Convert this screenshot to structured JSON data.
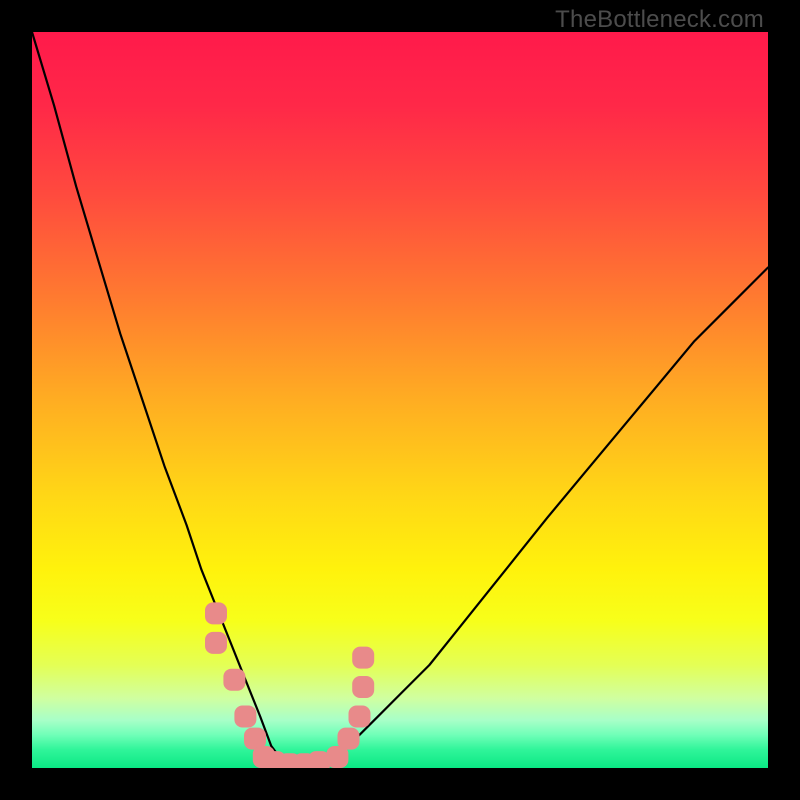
{
  "watermark": "TheBottleneck.com",
  "gradient_stops": [
    {
      "offset": 0.0,
      "color": "#ff1a4b"
    },
    {
      "offset": 0.1,
      "color": "#ff2848"
    },
    {
      "offset": 0.22,
      "color": "#ff4a3e"
    },
    {
      "offset": 0.36,
      "color": "#ff7a30"
    },
    {
      "offset": 0.5,
      "color": "#ffad22"
    },
    {
      "offset": 0.63,
      "color": "#ffd716"
    },
    {
      "offset": 0.73,
      "color": "#fff20c"
    },
    {
      "offset": 0.8,
      "color": "#f7ff1a"
    },
    {
      "offset": 0.86,
      "color": "#e4ff55"
    },
    {
      "offset": 0.905,
      "color": "#d0ffa0"
    },
    {
      "offset": 0.935,
      "color": "#a8ffc8"
    },
    {
      "offset": 0.955,
      "color": "#70ffb8"
    },
    {
      "offset": 0.975,
      "color": "#30f59a"
    },
    {
      "offset": 1.0,
      "color": "#0ae884"
    }
  ],
  "chart_data": {
    "type": "line",
    "title": "",
    "xlabel": "",
    "ylabel": "",
    "xlim": [
      0,
      100
    ],
    "ylim": [
      0,
      100
    ],
    "grid": false,
    "legend": false,
    "series": [
      {
        "name": "bottleneck-curve",
        "x": [
          0,
          3,
          6,
          9,
          12,
          15,
          18,
          21,
          23,
          25,
          27,
          29,
          31,
          32.5,
          34,
          36,
          38,
          41,
          43,
          46,
          50,
          54,
          58,
          62,
          66,
          70,
          75,
          80,
          85,
          90,
          95,
          100
        ],
        "y": [
          100,
          90,
          79,
          69,
          59,
          50,
          41,
          33,
          27,
          22,
          17,
          12,
          7,
          3,
          1,
          0,
          0,
          1,
          3,
          6,
          10,
          14,
          19,
          24,
          29,
          34,
          40,
          46,
          52,
          58,
          63,
          68
        ]
      }
    ],
    "markers": [
      {
        "name": "left-cluster",
        "color": "#e88a8a",
        "points": [
          {
            "x": 25.0,
            "y": 21
          },
          {
            "x": 25.0,
            "y": 17
          },
          {
            "x": 27.5,
            "y": 12
          },
          {
            "x": 29.0,
            "y": 7
          },
          {
            "x": 30.3,
            "y": 4
          },
          {
            "x": 31.5,
            "y": 1.5
          },
          {
            "x": 33.0,
            "y": 0.8
          },
          {
            "x": 35.0,
            "y": 0.5
          },
          {
            "x": 37.0,
            "y": 0.5
          },
          {
            "x": 39.0,
            "y": 0.8
          }
        ]
      },
      {
        "name": "right-cluster",
        "color": "#e88a8a",
        "points": [
          {
            "x": 41.5,
            "y": 1.5
          },
          {
            "x": 43.0,
            "y": 4
          },
          {
            "x": 44.5,
            "y": 7
          },
          {
            "x": 45.0,
            "y": 11
          },
          {
            "x": 45.0,
            "y": 15
          }
        ]
      }
    ]
  }
}
